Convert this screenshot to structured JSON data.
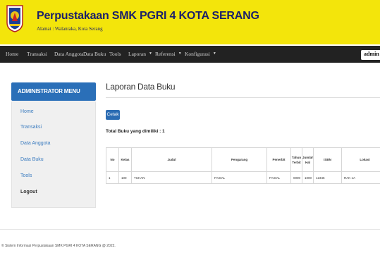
{
  "header": {
    "title": "Perpustakaan SMK PGRI 4 KOTA SERANG",
    "address": "Alamat : Walantaka, Kota Serang",
    "logo_icon": "school-crest-icon"
  },
  "navbar": {
    "items": [
      {
        "label": "Home",
        "dropdown": false
      },
      {
        "label": "Transaksi",
        "dropdown": false
      },
      {
        "label": "Data Anggota",
        "dropdown": false
      },
      {
        "label": "Data Buku",
        "dropdown": false
      },
      {
        "label": "Tools",
        "dropdown": false
      },
      {
        "label": "Laporan",
        "dropdown": true
      },
      {
        "label": "Referensi",
        "dropdown": true
      },
      {
        "label": "Konfigurasi",
        "dropdown": true
      }
    ],
    "caret": "▼",
    "user_label": "admin"
  },
  "sidebar": {
    "title": "ADMINISTRATOR MENU",
    "items": [
      {
        "label": "Home"
      },
      {
        "label": "Transaksi"
      },
      {
        "label": "Data Anggota"
      },
      {
        "label": "Data Buku"
      },
      {
        "label": "Tools"
      },
      {
        "label": "Logout"
      }
    ]
  },
  "main": {
    "heading": "Laporan Data Buku",
    "print_label": "Cetak",
    "total_text": "Total Buku yang dimiliki : 1",
    "table": {
      "columns": [
        "No",
        "Kelas",
        "Judul",
        "Pengarang",
        "Penerbit",
        "Tahun Terbit",
        "Jumlah Hal",
        "ISBN",
        "Lokasi"
      ],
      "rows": [
        [
          "1",
          "100",
          "TUHAN",
          "FAISAL",
          "FAISAL",
          "0000",
          "1000",
          "12345",
          "RAK 1A"
        ]
      ]
    }
  },
  "footer": {
    "text": "© Sistem Informasi Perpustakaan SMK PGRI 4 KOTA SERANG @ 2022."
  },
  "colors": {
    "header_bg": "#f3e50b",
    "title_color": "#1a1f6b",
    "navbar_bg": "#222222",
    "accent_blue": "#2a6fb8",
    "link_blue": "#3a7bbf"
  }
}
